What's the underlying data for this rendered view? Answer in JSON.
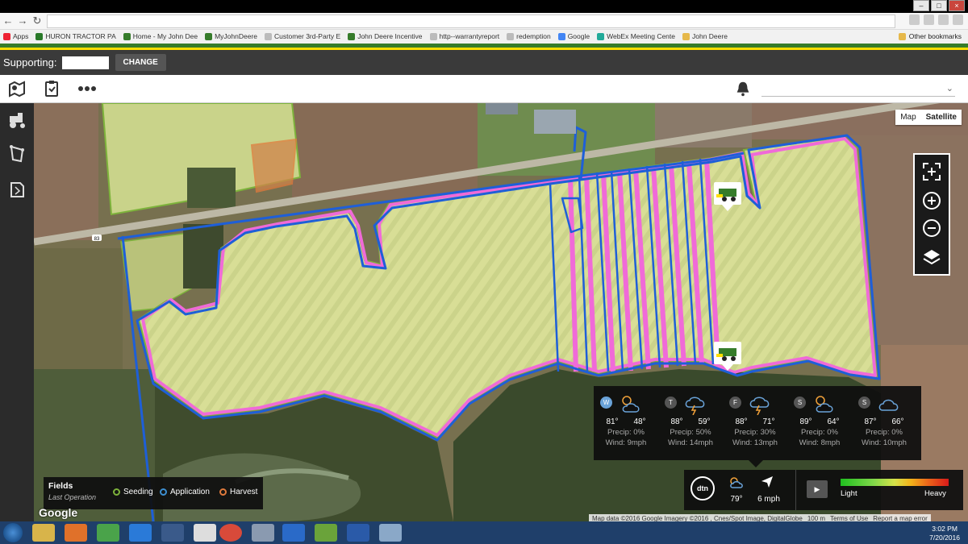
{
  "browser": {
    "bookmarks": [
      {
        "label": "Apps",
        "color": "#e23"
      },
      {
        "label": "HURON TRACTOR PA",
        "color": "#2a7a2a"
      },
      {
        "label": "Home - My John Dee",
        "color": "#367c2b"
      },
      {
        "label": "MyJohnDeere",
        "color": "#367c2b"
      },
      {
        "label": "Customer 3rd-Party E",
        "color": "#bbb"
      },
      {
        "label": "John Deere Incentive",
        "color": "#367c2b"
      },
      {
        "label": "http--warrantyreport",
        "color": "#bbb"
      },
      {
        "label": "redemption",
        "color": "#bbb"
      },
      {
        "label": "Google",
        "color": "#4285f4"
      },
      {
        "label": "WebEx Meeting Cente",
        "color": "#2a9"
      },
      {
        "label": "John Deere",
        "color": "#e6b84a"
      }
    ],
    "other_bookmarks": "Other bookmarks"
  },
  "support_bar": {
    "label": "Supporting:",
    "change_label": "CHANGE"
  },
  "map": {
    "type_map": "Map",
    "type_satellite": "Satellite",
    "road_label": "83",
    "google": "Google",
    "attribution": {
      "data": "Map data ©2016 Google Imagery ©2016 , Cnes/Spot Image, DigitalGlobe",
      "scale": "100 m",
      "terms": "Terms of Use",
      "report": "Report a map error"
    }
  },
  "weather": {
    "days": [
      {
        "letter": "W",
        "high": "81°",
        "low": "48°",
        "precip": "Precip: 0%",
        "wind": "Wind: 9mph",
        "icon": "partly-sunny-icon",
        "today": true
      },
      {
        "letter": "T",
        "high": "88°",
        "low": "59°",
        "precip": "Precip: 50%",
        "wind": "Wind: 14mph",
        "icon": "thunderstorm-icon",
        "today": false
      },
      {
        "letter": "F",
        "high": "88°",
        "low": "71°",
        "precip": "Precip: 30%",
        "wind": "Wind: 13mph",
        "icon": "thunderstorm-icon",
        "today": false
      },
      {
        "letter": "S",
        "high": "89°",
        "low": "64°",
        "precip": "Precip: 0%",
        "wind": "Wind: 8mph",
        "icon": "partly-sunny-icon",
        "today": false
      },
      {
        "letter": "S",
        "high": "87°",
        "low": "66°",
        "precip": "Precip: 0%",
        "wind": "Wind: 10mph",
        "icon": "cloudy-icon",
        "today": false
      }
    ]
  },
  "dtn": {
    "logo": "dtn",
    "current_temp": "79°",
    "current_wind": "6 mph",
    "scale_light": "Light",
    "scale_heavy": "Heavy"
  },
  "legend": {
    "title": "Fields",
    "subtitle": "Last Operation",
    "items": [
      {
        "label": "Seeding",
        "color": "#7db33b"
      },
      {
        "label": "Application",
        "color": "#3d8fd1"
      },
      {
        "label": "Harvest",
        "color": "#e07a3c"
      }
    ]
  },
  "taskbar": {
    "time": "3:02 PM",
    "date": "7/20/2016"
  },
  "colors": {
    "field_boundary_blue": "#1e5fd8",
    "coverage_pink": "#f06ad8",
    "deere_green": "#367c2b",
    "deere_yellow": "#ffde00"
  }
}
